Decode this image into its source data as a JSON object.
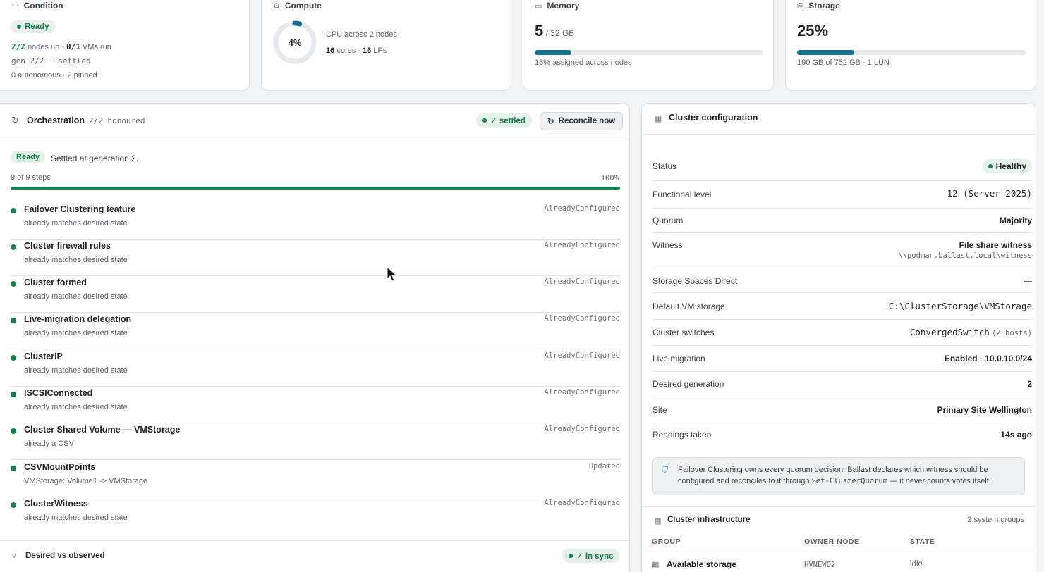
{
  "condition": {
    "title": "Condition",
    "status": "Ready",
    "nodes_up": "2/2",
    "nodes_up_suffix": "nodes up ·",
    "vms_run": "0/1",
    "vms_run_suffix": "VMs run",
    "gen_line": "gen 2/2 · settled",
    "footer": "0 autonomous · 2 pinned"
  },
  "compute": {
    "title": "Compute",
    "percent": "4%",
    "percent_value": 4,
    "line1": "CPU across 2 nodes",
    "cores": "16",
    "cores_label": "cores ·",
    "lps": "16",
    "lps_label": "LPs"
  },
  "memory": {
    "title": "Memory",
    "value": "5",
    "unit": "/ 32 GB",
    "fraction": 0.16,
    "caption": "16% assigned across nodes"
  },
  "storage": {
    "title": "Storage",
    "value": "25%",
    "fraction": 0.25,
    "caption": "190 GB of 752 GB · 1 LUN"
  },
  "orchestration": {
    "title": "Orchestration",
    "honoured": "2/2 honoured",
    "settled_badge": "✓ settled",
    "reconcile_button": "Reconcile now",
    "ready_badge": "Ready",
    "settled_text": "Settled at generation",
    "settled_gen": "2.",
    "steps_label": "9 of 9 steps",
    "progress_label": "100%",
    "progress_fraction": 1.0,
    "steps": [
      {
        "title": "Failover Clustering feature",
        "desc": "already matches desired state",
        "status": "AlreadyConfigured"
      },
      {
        "title": "Cluster firewall rules",
        "desc": "already matches desired state",
        "status": "AlreadyConfigured"
      },
      {
        "title": "Cluster formed",
        "desc": "already matches desired state",
        "status": "AlreadyConfigured"
      },
      {
        "title": "Live-migration delegation",
        "desc": "already matches desired state",
        "status": "AlreadyConfigured"
      },
      {
        "title": "ClusterIP",
        "desc": "already matches desired state",
        "status": "AlreadyConfigured"
      },
      {
        "title": "ISCSIConnected",
        "desc": "already matches desired state",
        "status": "AlreadyConfigured"
      },
      {
        "title": "Cluster Shared Volume — VMStorage",
        "desc": "already a CSV",
        "status": "AlreadyConfigured"
      },
      {
        "title": "CSVMountPoints",
        "desc": "VMStorage: Volume1 -> VMStorage",
        "status": "Updated"
      },
      {
        "title": "ClusterWitness",
        "desc": "already matches desired state",
        "status": "AlreadyConfigured"
      }
    ]
  },
  "desired": {
    "title": "Desired vs observed",
    "badge": "✓ In sync"
  },
  "cluster_config": {
    "title": "Cluster configuration",
    "status_label": "Status",
    "status_value": "Healthy",
    "functional_label": "Functional level",
    "functional_value": "12 (Server 2025)",
    "quorum_label": "Quorum",
    "quorum_value": "Majority",
    "witness_label": "Witness",
    "witness_value": "File share witness",
    "witness_path": "\\\\podman.ballast.local\\witness",
    "s2d_label": "Storage Spaces Direct",
    "s2d_value": "—",
    "vmstorage_label": "Default VM storage",
    "vmstorage_value": "C:\\ClusterStorage\\VMStorage",
    "switches_label": "Cluster switches",
    "switches_value": "ConvergedSwitch",
    "switches_hosts": "(2 hosts)",
    "livemig_label": "Live migration",
    "livemig_value": "Enabled · 10.0.10.0/24",
    "gen_label": "Desired generation",
    "gen_value": "2",
    "site_label": "Site",
    "site_value": "Primary Site Wellington",
    "readings_label": "Readings taken",
    "readings_value": "14s ago",
    "note_pre": "Failover Clustering owns every quorum decision. Ballast declares which witness should be configured and reconciles to it through",
    "note_code": "Set-ClusterQuorum",
    "note_post": "— it never counts votes itself."
  },
  "infra": {
    "title": "Cluster infrastructure",
    "count": "2 system groups",
    "col_group": "GROUP",
    "col_owner": "OWNER NODE",
    "col_state": "STATE",
    "row_group": "Available storage",
    "row_owner": "HVNEW02",
    "row_state": "idle"
  }
}
